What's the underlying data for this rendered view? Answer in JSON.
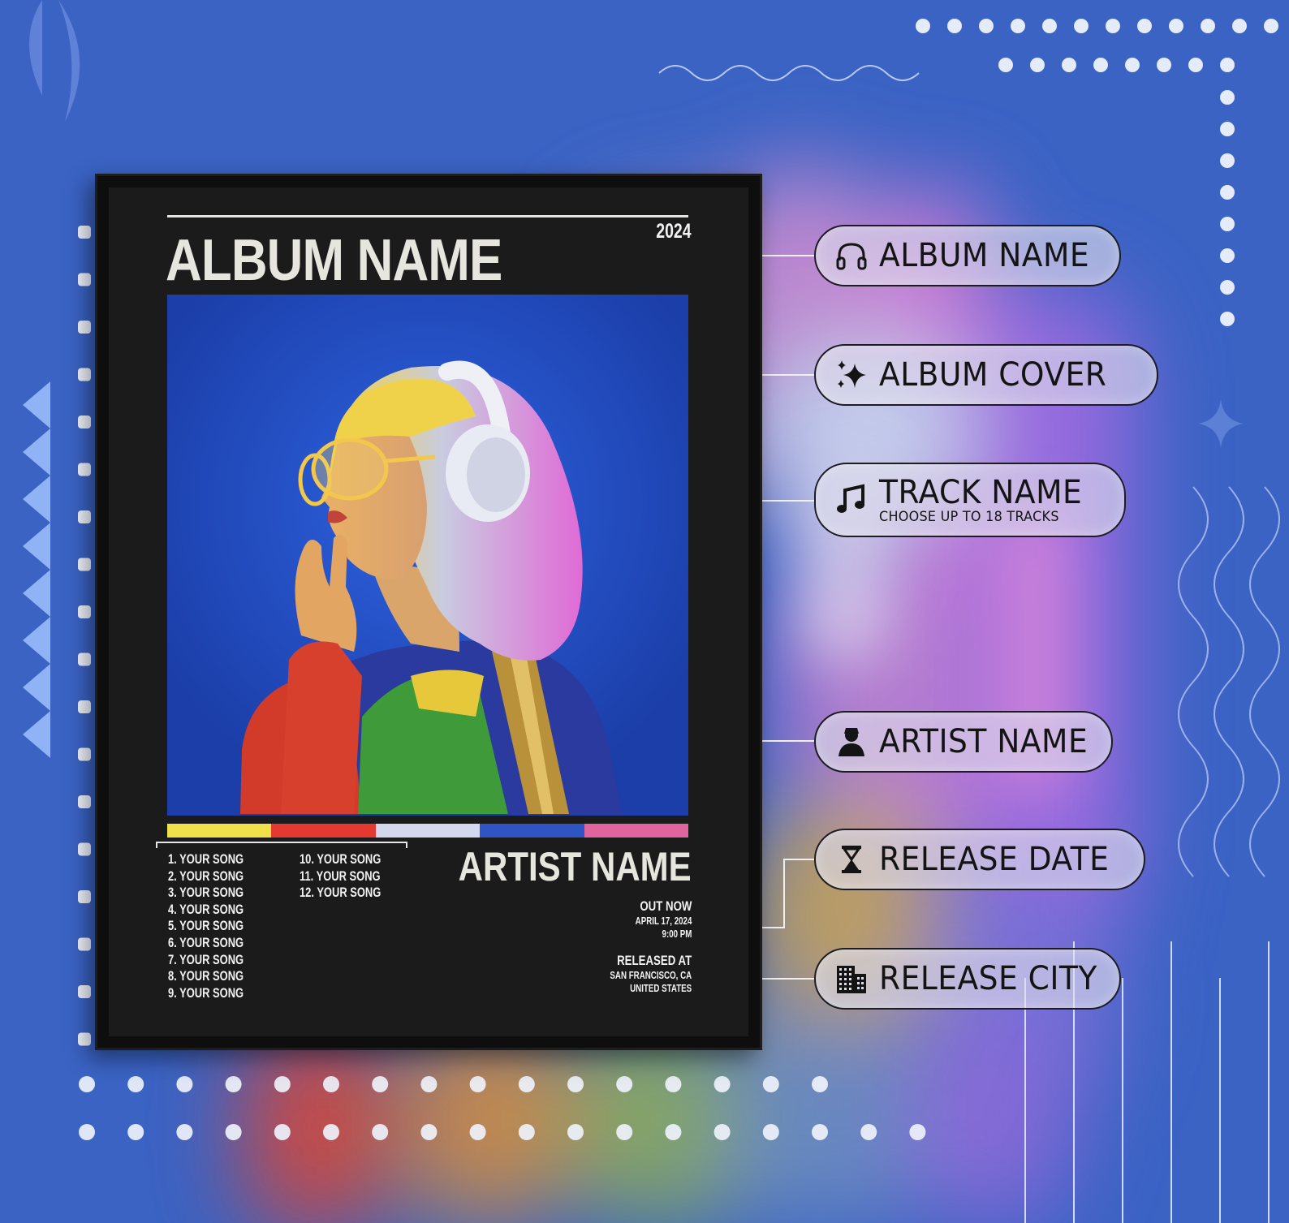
{
  "poster": {
    "year": "2024",
    "album_name": "ALBUM NAME",
    "color_palette": [
      "#f0e04a",
      "#e43930",
      "#d4d8ee",
      "#2f55c4",
      "#e2649c"
    ],
    "tracks": [
      "1. YOUR SONG",
      "2. YOUR SONG",
      "3. YOUR SONG",
      "4. YOUR SONG",
      "5. YOUR SONG",
      "6. YOUR SONG",
      "7. YOUR SONG",
      "8. YOUR SONG",
      "9. YOUR SONG",
      "10. YOUR SONG",
      "11. YOUR SONG",
      "12. YOUR SONG"
    ],
    "artist_name": "ARTIST NAME",
    "out_now": "OUT NOW",
    "release_date": "APRIL 17, 2024",
    "release_time": "9:00 PM",
    "released_at": "RELEASED AT",
    "release_city": "SAN FRANCISCO, CA",
    "release_country": "UNITED STATES"
  },
  "labels": {
    "album_name": {
      "text": "ALBUM NAME",
      "icon": "headphones-icon"
    },
    "album_cover": {
      "text": "ALBUM COVER",
      "icon": "sparkles-icon"
    },
    "track_name": {
      "text": "TRACK NAME",
      "subtext": "CHOOSE UP TO 18 TRACKS",
      "icon": "music-note-icon"
    },
    "artist_name": {
      "text": "ARTIST NAME",
      "icon": "person-icon"
    },
    "release_date": {
      "text": "RELEASE DATE",
      "icon": "hourglass-icon"
    },
    "release_city": {
      "text": "RELEASE CITY",
      "icon": "building-icon"
    }
  },
  "colors": {
    "background": "#3a63c4",
    "poster_bg": "#1b1b1b",
    "poster_text": "#e6e6df"
  }
}
